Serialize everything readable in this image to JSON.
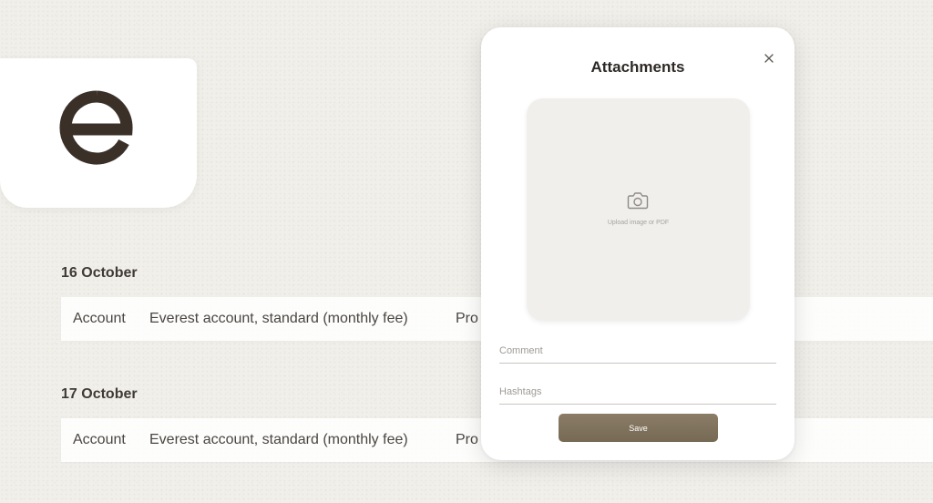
{
  "brand": {
    "logo_icon": "e-logo-icon",
    "color": "#3a3028"
  },
  "days": [
    {
      "label": "16 October",
      "row": {
        "type": "Account",
        "description": "Everest account, standard (monthly fee)",
        "status": "Pro"
      }
    },
    {
      "label": "17 October",
      "row": {
        "type": "Account",
        "description": "Everest account, standard (monthly fee)",
        "status": "Pro"
      }
    }
  ],
  "modal": {
    "title": "Attachments",
    "close_icon": "close-icon",
    "upload": {
      "icon": "camera-icon",
      "text": "Upload image or PDF"
    },
    "comment_placeholder": "Comment",
    "hashtags_placeholder": "Hashtags",
    "save_label": "Save",
    "accent_color": "#807259"
  }
}
